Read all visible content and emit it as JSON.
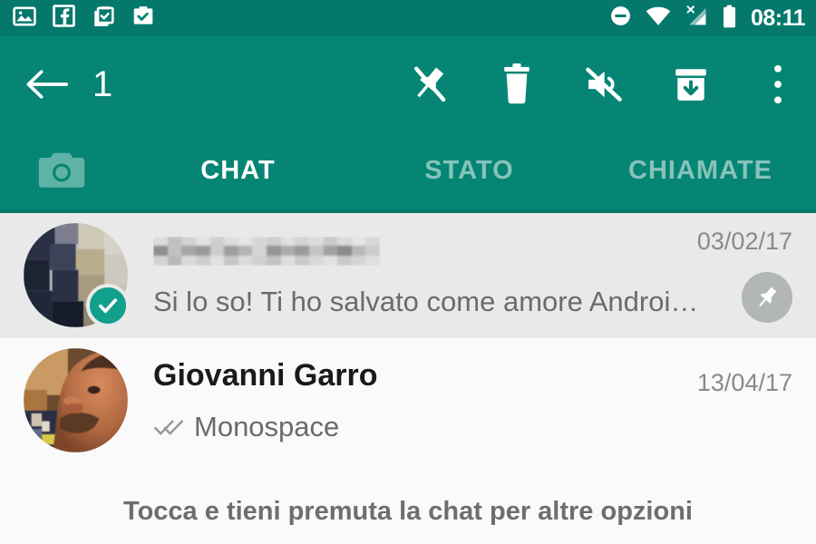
{
  "status_bar": {
    "time": "08:11",
    "left_icons": [
      {
        "name": "photo-icon"
      },
      {
        "name": "facebook-icon"
      },
      {
        "name": "clipboard-check-icon"
      },
      {
        "name": "clipboard-check-filled-icon"
      }
    ],
    "right_icons": [
      {
        "name": "do-not-disturb-icon"
      },
      {
        "name": "wifi-icon"
      },
      {
        "name": "no-sim-signal-icon"
      },
      {
        "name": "battery-full-icon"
      }
    ]
  },
  "toolbar": {
    "back_label": "back-arrow",
    "selection_count": "1",
    "actions": [
      {
        "name": "unpin-icon",
        "label": "Rimuovi dalle chat in alto"
      },
      {
        "name": "delete-icon",
        "label": "Elimina"
      },
      {
        "name": "mute-icon",
        "label": "Silenzia"
      },
      {
        "name": "archive-icon",
        "label": "Archivia"
      },
      {
        "name": "overflow-menu-icon",
        "label": "Altro"
      }
    ]
  },
  "tabs": {
    "camera_label": "camera-icon",
    "items": [
      {
        "label": "CHAT",
        "active": true
      },
      {
        "label": "STATO",
        "active": false
      },
      {
        "label": "CHIAMATE",
        "active": false
      }
    ]
  },
  "chats": [
    {
      "name": "",
      "name_censored": true,
      "preview": "Si lo so! Ti ho salvato come amore Androi…",
      "date": "03/02/17",
      "selected": true,
      "pinned": true,
      "has_ticks": false
    },
    {
      "name": "Giovanni Garro",
      "name_censored": false,
      "preview": "Monospace",
      "date": "13/04/17",
      "selected": false,
      "pinned": false,
      "has_ticks": true
    }
  ],
  "hint": {
    "text": "Tocca e tieni premuta la chat per altre opzioni"
  },
  "colors": {
    "header_green": "#068574",
    "status_green": "#04796b",
    "accent_check": "#10a08c",
    "selected_row": "#e9e9e9",
    "pin_badge": "#b3b6b6",
    "inactive_tab": "#86c3b9"
  }
}
